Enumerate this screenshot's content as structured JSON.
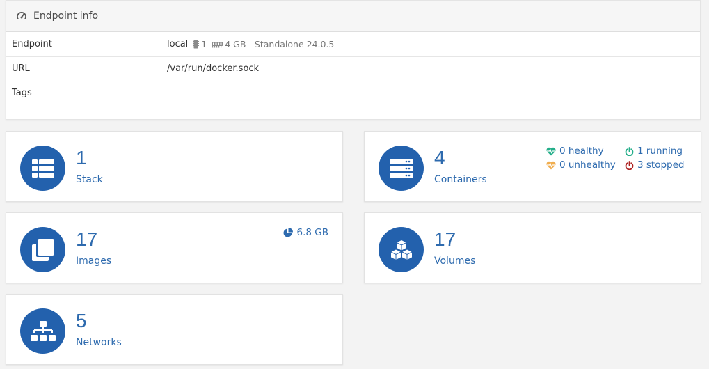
{
  "endpoint_info": {
    "header_title": "Endpoint info",
    "endpoint_label": "Endpoint",
    "endpoint_name": "local",
    "cpu_count": "1",
    "memory_info": "4 GB - Standalone 24.0.5",
    "url_label": "URL",
    "url_value": "/var/run/docker.sock",
    "tags_label": "Tags"
  },
  "tiles": {
    "stacks": {
      "count": "1",
      "label": "Stack",
      "icon": "list-icon"
    },
    "containers": {
      "count": "4",
      "label": "Containers",
      "icon": "server-icon",
      "healthy": "0 healthy",
      "unhealthy": "0 unhealthy",
      "running": "1 running",
      "stopped": "3 stopped"
    },
    "images": {
      "count": "17",
      "label": "Images",
      "icon": "clone-icon",
      "size": "6.8 GB"
    },
    "volumes": {
      "count": "17",
      "label": "Volumes",
      "icon": "cubes-icon"
    },
    "networks": {
      "count": "5",
      "label": "Networks",
      "icon": "sitemap-icon"
    }
  },
  "colors": {
    "accent": "#2361ad",
    "text_accent": "#2d6aae",
    "healthy": "#23ae89",
    "unhealthy": "#f0ad4e",
    "running": "#23ae89",
    "stopped": "#ae2323"
  }
}
